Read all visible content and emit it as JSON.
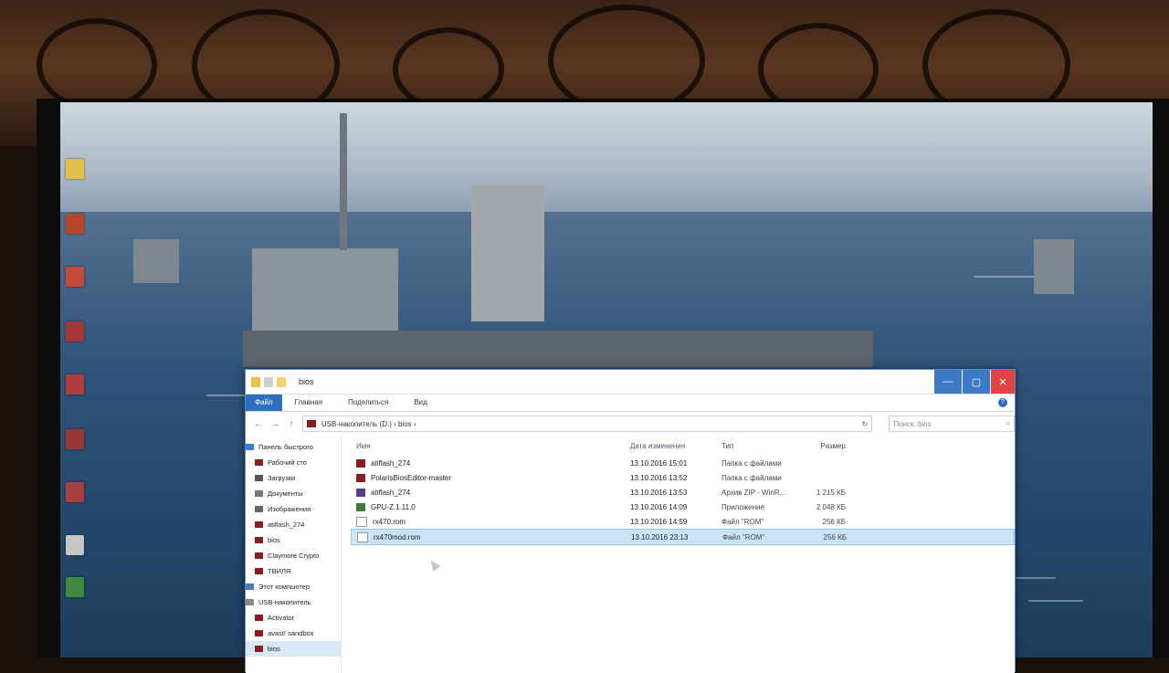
{
  "window": {
    "title": "bios",
    "controls": {
      "minimize": "—",
      "maximize": "▢",
      "close": "✕"
    }
  },
  "ribbon": {
    "tabs": [
      "Файл",
      "Главная",
      "Поделиться",
      "Вид"
    ],
    "help": "?"
  },
  "navigation": {
    "back": "←",
    "forward": "→",
    "up": "↑",
    "address": "USB-накопитель (D:) › bios ›",
    "refresh": "↻",
    "search_placeholder": "Поиск: bios",
    "search_icon": "⌕"
  },
  "nav_pane": {
    "items": [
      "Панель быстрого",
      "Рабочий сто",
      "Загрузки",
      "Документы",
      "Изображения",
      "atiflash_274",
      "bios",
      "Claymore Crypto",
      "ТВИЛЯ",
      "Этот компьютер",
      "USB-накопитель",
      "Activator",
      "avast! sandbox",
      "bios"
    ]
  },
  "columns": {
    "name": "Имя",
    "date": "Дата изменения",
    "type": "Тип",
    "size": "Размер"
  },
  "files": [
    {
      "name": "atiflash_274",
      "date": "13.10.2016 15:01",
      "type": "Папка с файлами",
      "size": ""
    },
    {
      "name": "PolarisBiosEditor-master",
      "date": "13.10.2016 13:52",
      "type": "Папка с файлами",
      "size": ""
    },
    {
      "name": "atiflash_274",
      "date": "13.10.2016 13:53",
      "type": "Архив ZIP - WinR...",
      "size": "1 215 КБ"
    },
    {
      "name": "GPU-Z.1.11.0",
      "date": "13.10.2016 14:09",
      "type": "Приложение",
      "size": "2 048 КБ"
    },
    {
      "name": "rx470.rom",
      "date": "13.10.2016 14:59",
      "type": "Файл \"ROM\"",
      "size": "256 КБ"
    },
    {
      "name": "rx470mod.rom",
      "date": "13.10.2016 23:13",
      "type": "Файл \"ROM\"",
      "size": "256 КБ"
    }
  ],
  "selected_file_index": 5,
  "colors": {
    "accent": "#2f6fbf",
    "selection": "#cde4f7",
    "close_button": "#e04343",
    "folder": "#8a1d1d"
  }
}
